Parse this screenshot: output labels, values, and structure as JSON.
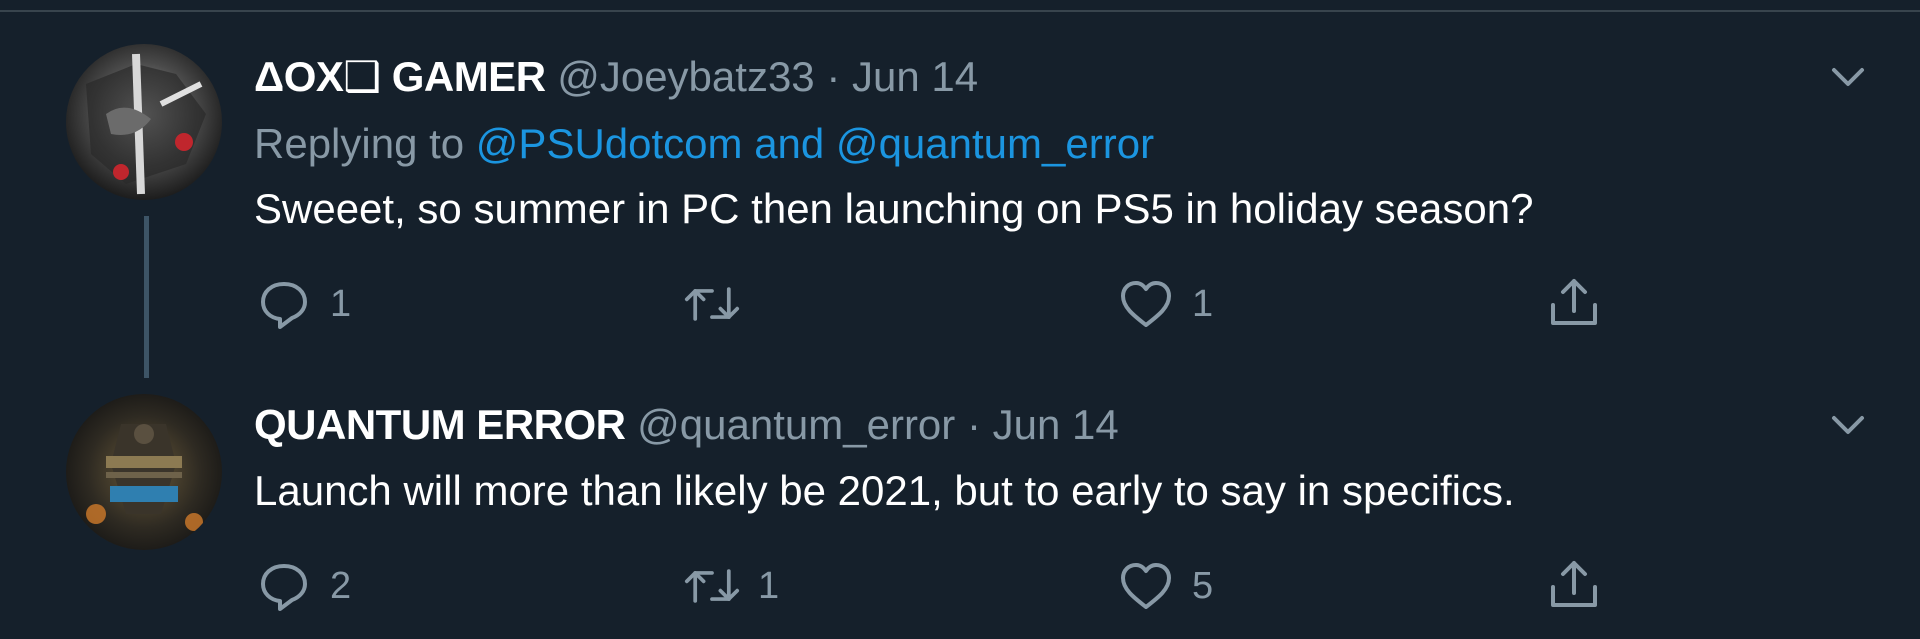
{
  "tweets": [
    {
      "display_name": "ΔOX❑ GAMER",
      "handle": "@Joeybatz33",
      "separator": "·",
      "date": "Jun 14",
      "replying_prefix": "Replying to ",
      "replying_to": "@PSUdotcom and @quantum_error",
      "text": "Sweeet, so summer in PC then launching on PS5 in holiday season?",
      "reply_count": "1",
      "retweet_count": "",
      "like_count": "1"
    },
    {
      "display_name": "QUANTUM ERROR",
      "handle": "@quantum_error",
      "separator": "·",
      "date": "Jun 14",
      "text": "Launch will more than likely be 2021, but to early to say in specifics.",
      "reply_count": "2",
      "retweet_count": "1",
      "like_count": "5"
    }
  ],
  "colors": {
    "background": "#15202b",
    "secondary_text": "#8899a6",
    "link": "#1b95e0",
    "thread_line": "#3d5466"
  },
  "icons": {
    "reply": "reply-icon",
    "retweet": "retweet-icon",
    "like": "heart-icon",
    "share": "share-icon",
    "more": "chevron-down-icon"
  }
}
